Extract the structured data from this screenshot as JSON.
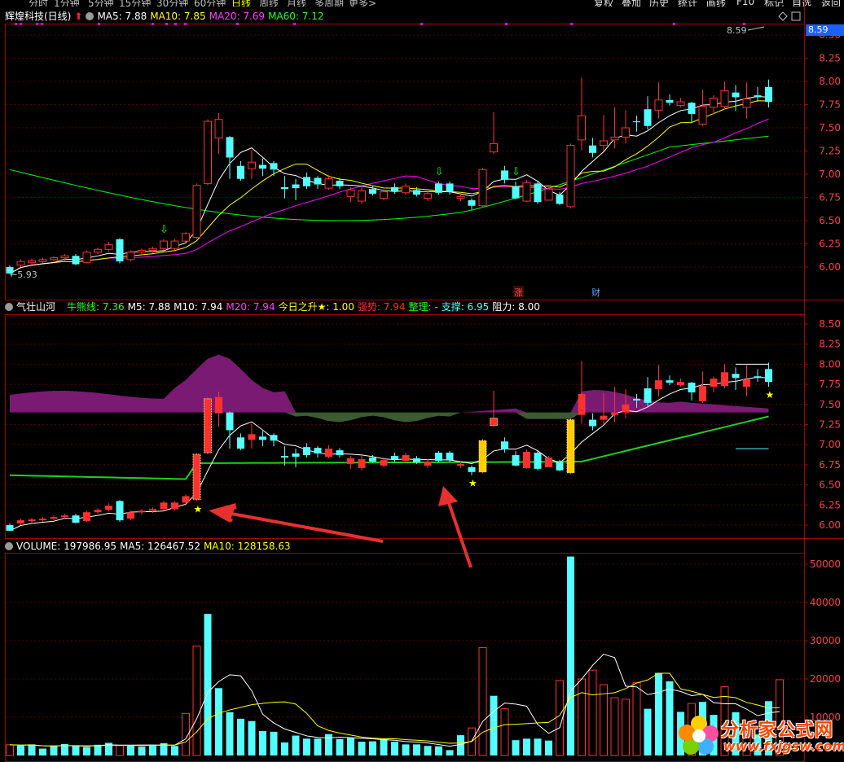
{
  "toolbar": {
    "periods": [
      "分时",
      "1分钟",
      "5分钟",
      "15分钟",
      "30分钟",
      "60分钟",
      "日线",
      "周线",
      "月线",
      "多周期",
      "更多>"
    ],
    "selected_period": "日线",
    "buttons": [
      "复权",
      "叠加",
      "历史",
      "统计",
      "画线",
      "F10",
      "标记",
      "自选",
      "返回"
    ]
  },
  "main_panel": {
    "stock_title": "辉煌科技(日线)",
    "ma5": "MA5: 7.88",
    "ma10": "MA10: 7.85",
    "ma20": "MA20: 7.69",
    "ma60": "MA60: 7.12",
    "high_label": "8.59",
    "low_label": "5.93",
    "price_box": "8.59",
    "event_marks": [
      "涨",
      "财"
    ],
    "yticks": [
      "8.50",
      "8.25",
      "8.00",
      "7.75",
      "7.50",
      "7.25",
      "7.00",
      "6.75",
      "6.50",
      "6.25",
      "6.00"
    ],
    "colors": {
      "ma5": "#ffffff",
      "ma10": "#ffff00",
      "ma20": "#ff00ff",
      "ma60": "#00ff00",
      "up": "#ff3030",
      "down": "#54ffff"
    }
  },
  "indicator_panel": {
    "name": "气壮山河",
    "niuxiong": "牛熊线: 7.36",
    "m5": "M5: 7.88",
    "m10": "M10: 7.94",
    "m20": "M20: 7.94",
    "jinri": "今日之升★: 1.00",
    "qiangshi": "强势: 7.94",
    "zhengli": "整理: -",
    "zhicheng": "支撑: 6.95",
    "zuli": "阻力: 8.00",
    "yticks": [
      "8.50",
      "8.25",
      "8.00",
      "7.75",
      "7.50",
      "7.25",
      "7.00",
      "6.75",
      "6.50",
      "6.25",
      "6.00"
    ]
  },
  "volume_panel": {
    "volume": "VOLUME: 197986.95",
    "ma5": "MA5: 126467.52",
    "ma10": "MA10: 128158.63",
    "yticks": [
      "50000",
      "40000",
      "30000",
      "20000",
      "10000"
    ]
  },
  "watermark": {
    "title": "分析家公式网",
    "url": "www.fxjgsw.com"
  },
  "chart_data": {
    "type": "candlestick",
    "days": 70,
    "candles": [
      [
        6.0,
        5.93,
        6.02,
        5.93
      ],
      [
        6.02,
        6.06,
        6.08,
        6.0
      ],
      [
        6.05,
        6.07,
        6.09,
        6.03
      ],
      [
        6.06,
        6.08,
        6.1,
        6.04
      ],
      [
        6.08,
        6.1,
        6.12,
        6.06
      ],
      [
        6.1,
        6.12,
        6.14,
        6.07
      ],
      [
        6.12,
        6.03,
        6.14,
        6.02
      ],
      [
        6.05,
        6.16,
        6.18,
        6.04
      ],
      [
        6.16,
        6.19,
        6.21,
        6.14
      ],
      [
        6.19,
        6.24,
        6.27,
        6.17
      ],
      [
        6.3,
        6.06,
        6.31,
        6.04
      ],
      [
        6.08,
        6.16,
        6.18,
        6.06
      ],
      [
        6.16,
        6.18,
        6.2,
        6.13
      ],
      [
        6.18,
        6.2,
        6.22,
        6.15
      ],
      [
        6.2,
        6.28,
        6.3,
        6.18
      ],
      [
        6.2,
        6.28,
        6.3,
        6.18
      ],
      [
        6.28,
        6.36,
        6.38,
        6.26
      ],
      [
        6.32,
        6.88,
        6.9,
        6.3
      ],
      [
        6.9,
        7.57,
        7.59,
        6.88
      ],
      [
        7.39,
        7.59,
        7.66,
        7.22
      ],
      [
        7.4,
        7.18,
        7.41,
        6.95
      ],
      [
        7.09,
        6.95,
        7.14,
        6.93
      ],
      [
        7.06,
        7.13,
        7.26,
        6.95
      ],
      [
        7.1,
        7.06,
        7.17,
        6.98
      ],
      [
        7.12,
        7.05,
        7.14,
        6.98
      ],
      [
        6.86,
        6.84,
        6.98,
        6.74
      ],
      [
        6.89,
        6.85,
        6.95,
        6.72
      ],
      [
        6.97,
        6.87,
        7.02,
        6.84
      ],
      [
        6.96,
        6.89,
        6.98,
        6.84
      ],
      [
        6.85,
        6.95,
        6.99,
        6.83
      ],
      [
        6.93,
        6.87,
        6.96,
        6.84
      ],
      [
        6.76,
        6.83,
        6.86,
        6.7
      ],
      [
        6.71,
        6.82,
        6.86,
        6.68
      ],
      [
        6.84,
        6.79,
        6.87,
        6.77
      ],
      [
        6.74,
        6.81,
        6.84,
        6.72
      ],
      [
        6.86,
        6.82,
        6.9,
        6.79
      ],
      [
        6.8,
        6.87,
        6.9,
        6.78
      ],
      [
        6.83,
        6.78,
        6.86,
        6.76
      ],
      [
        6.74,
        6.79,
        6.82,
        6.71
      ],
      [
        6.9,
        6.8,
        6.92,
        6.78
      ],
      [
        6.9,
        6.81,
        6.92,
        6.78
      ],
      [
        6.74,
        6.76,
        6.8,
        6.71
      ],
      [
        6.72,
        6.66,
        6.74,
        6.62
      ],
      [
        6.66,
        7.05,
        7.07,
        6.64
      ],
      [
        7.24,
        7.33,
        7.67,
        7.22
      ],
      [
        7.04,
        6.94,
        7.09,
        6.9
      ],
      [
        6.87,
        6.74,
        6.92,
        6.73
      ],
      [
        6.71,
        6.91,
        6.94,
        6.7
      ],
      [
        6.9,
        6.7,
        6.93,
        6.68
      ],
      [
        6.72,
        6.84,
        6.86,
        6.72
      ],
      [
        6.78,
        6.68,
        6.81,
        6.67
      ],
      [
        6.65,
        7.31,
        7.33,
        6.63
      ],
      [
        7.37,
        7.63,
        8.04,
        7.26
      ],
      [
        7.31,
        7.23,
        7.39,
        7.18
      ],
      [
        7.31,
        7.36,
        7.64,
        7.25
      ],
      [
        7.37,
        7.4,
        7.72,
        7.28
      ],
      [
        7.4,
        7.5,
        7.69,
        7.33
      ],
      [
        7.57,
        7.56,
        7.63,
        7.46
      ],
      [
        7.7,
        7.52,
        7.84,
        7.48
      ],
      [
        7.69,
        7.8,
        7.99,
        7.6
      ],
      [
        7.8,
        7.77,
        7.86,
        7.74
      ],
      [
        7.74,
        7.78,
        7.82,
        7.72
      ],
      [
        7.77,
        7.65,
        7.78,
        7.55
      ],
      [
        7.54,
        7.73,
        7.91,
        7.52
      ],
      [
        7.72,
        7.82,
        7.85,
        7.65
      ],
      [
        7.73,
        7.9,
        8.0,
        7.7
      ],
      [
        7.88,
        7.83,
        7.96,
        7.68
      ],
      [
        7.72,
        7.81,
        7.99,
        7.6
      ],
      [
        7.85,
        7.83,
        7.94,
        7.78
      ],
      [
        7.94,
        7.78,
        8.02,
        7.72
      ]
    ],
    "volume": [
      [
        2800,
        0
      ],
      [
        2600,
        1
      ],
      [
        2900,
        1
      ],
      [
        1800,
        1
      ],
      [
        2400,
        1
      ],
      [
        3000,
        1
      ],
      [
        2600,
        1
      ],
      [
        2200,
        1
      ],
      [
        2800,
        1
      ],
      [
        3300,
        1
      ],
      [
        2600,
        0
      ],
      [
        2700,
        1
      ],
      [
        2300,
        1
      ],
      [
        2800,
        1
      ],
      [
        3200,
        1
      ],
      [
        2500,
        1
      ],
      [
        11000,
        0
      ],
      [
        28600,
        0
      ],
      [
        37000,
        1
      ],
      [
        17600,
        1
      ],
      [
        11300,
        1
      ],
      [
        9600,
        1
      ],
      [
        9000,
        1
      ],
      [
        6400,
        1
      ],
      [
        6200,
        1
      ],
      [
        3400,
        1
      ],
      [
        5200,
        1
      ],
      [
        4400,
        1
      ],
      [
        4400,
        1
      ],
      [
        5600,
        1
      ],
      [
        4300,
        1
      ],
      [
        4600,
        1
      ],
      [
        3600,
        1
      ],
      [
        3700,
        1
      ],
      [
        4400,
        1
      ],
      [
        3600,
        1
      ],
      [
        2900,
        1
      ],
      [
        2900,
        1
      ],
      [
        2500,
        1
      ],
      [
        2400,
        1
      ],
      [
        1400,
        1
      ],
      [
        5300,
        1
      ],
      [
        7200,
        0
      ],
      [
        28200,
        0
      ],
      [
        15600,
        1
      ],
      [
        12200,
        0
      ],
      [
        4000,
        1
      ],
      [
        4400,
        1
      ],
      [
        4400,
        1
      ],
      [
        3900,
        1
      ],
      [
        19600,
        0
      ],
      [
        52000,
        1
      ],
      [
        20000,
        0
      ],
      [
        22300,
        0
      ],
      [
        18500,
        0
      ],
      [
        15100,
        0
      ],
      [
        14700,
        0
      ],
      [
        19000,
        0
      ],
      [
        12200,
        1
      ],
      [
        21600,
        1
      ],
      [
        19400,
        1
      ],
      [
        11400,
        1
      ],
      [
        13600,
        0
      ],
      [
        14000,
        1
      ],
      [
        10600,
        1
      ],
      [
        18000,
        0
      ],
      [
        11300,
        1
      ],
      [
        6600,
        0
      ],
      [
        5500,
        1
      ],
      [
        14200,
        1
      ],
      [
        19800,
        0
      ]
    ],
    "price_ylim": [
      5.9,
      8.6
    ],
    "volume_ylim": [
      0,
      55000
    ]
  }
}
